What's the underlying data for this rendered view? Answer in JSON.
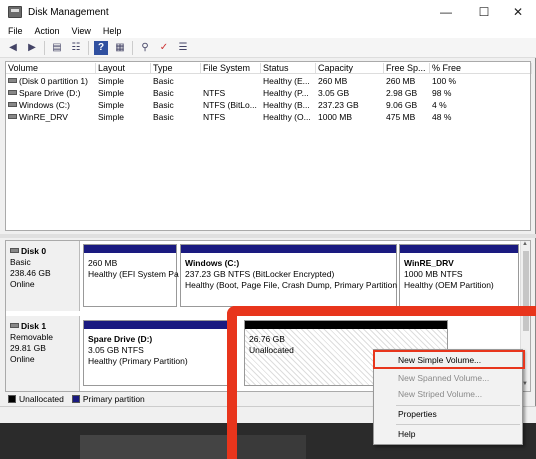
{
  "window": {
    "title": "Disk Management",
    "minimize": "—",
    "maximize": "☐",
    "close": "✕"
  },
  "menu": [
    "File",
    "Action",
    "View",
    "Help"
  ],
  "volume_list": {
    "columns": [
      "Volume",
      "Layout",
      "Type",
      "File System",
      "Status",
      "Capacity",
      "Free Sp...",
      "% Free"
    ],
    "rows": [
      [
        "(Disk 0 partition 1)",
        "Simple",
        "Basic",
        "",
        "Healthy (E...",
        "260 MB",
        "260 MB",
        "100 %"
      ],
      [
        "Spare Drive (D:)",
        "Simple",
        "Basic",
        "NTFS",
        "Healthy (P...",
        "3.05 GB",
        "2.98 GB",
        "98 %"
      ],
      [
        "Windows (C:)",
        "Simple",
        "Basic",
        "NTFS (BitLo...",
        "Healthy (B...",
        "237.23 GB",
        "9.06 GB",
        "4 %"
      ],
      [
        "WinRE_DRV",
        "Simple",
        "Basic",
        "NTFS",
        "Healthy (O...",
        "1000 MB",
        "475 MB",
        "48 %"
      ]
    ]
  },
  "disks": [
    {
      "name": "Disk 0",
      "type": "Basic",
      "size": "238.46 GB",
      "state": "Online",
      "partitions": [
        {
          "name": "",
          "size": "260 MB",
          "status": "Healthy (EFI System Pa"
        },
        {
          "name": "Windows  (C:)",
          "size": "237.23 GB NTFS (BitLocker Encrypted)",
          "status": "Healthy (Boot, Page File, Crash Dump, Primary Partition"
        },
        {
          "name": "WinRE_DRV",
          "size": "1000 MB NTFS",
          "status": "Healthy (OEM Partition)"
        }
      ]
    },
    {
      "name": "Disk 1",
      "type": "Removable",
      "size": "29.81 GB",
      "state": "Online",
      "partitions": [
        {
          "name": "Spare Drive  (D:)",
          "size": "3.05 GB NTFS",
          "status": "Healthy (Primary Partition)"
        },
        {
          "name": "",
          "size": "26.76 GB",
          "status": "Unallocated"
        }
      ]
    }
  ],
  "legend": [
    {
      "label": "Unallocated",
      "color": "#000000"
    },
    {
      "label": "Primary partition",
      "color": "#1a1a80"
    }
  ],
  "context_menu": {
    "items": [
      {
        "label": "New Simple Volume...",
        "enabled": true
      },
      {
        "label": "New Spanned Volume...",
        "enabled": false
      },
      {
        "label": "New Striped Volume...",
        "enabled": false
      },
      {
        "label": "Properties",
        "enabled": true
      },
      {
        "label": "Help",
        "enabled": true
      }
    ]
  },
  "highlight_color": "#e8351c"
}
